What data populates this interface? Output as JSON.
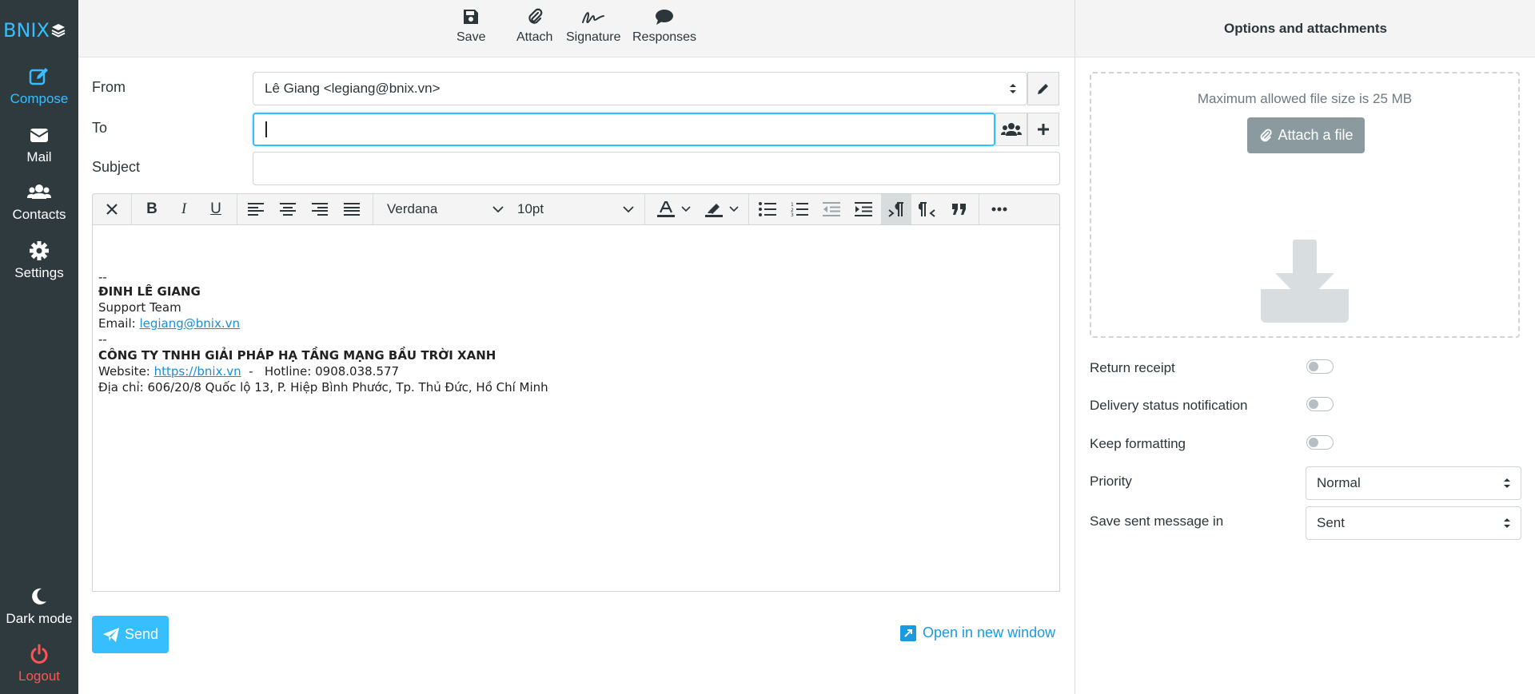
{
  "nav": {
    "logo_text": "BNIX",
    "items": [
      {
        "label": "Compose",
        "icon": "compose-icon"
      },
      {
        "label": "Mail",
        "icon": "envelope-icon"
      },
      {
        "label": "Contacts",
        "icon": "users-icon"
      },
      {
        "label": "Settings",
        "icon": "gear-icon"
      }
    ],
    "bottom": [
      {
        "label": "Dark mode",
        "icon": "moon-icon"
      },
      {
        "label": "Logout",
        "icon": "power-icon"
      }
    ]
  },
  "toolbar": {
    "save": "Save",
    "attach": "Attach",
    "signature": "Signature",
    "responses": "Responses"
  },
  "form": {
    "from_label": "From",
    "from_value": "Lê Giang <legiang@bnix.vn>",
    "to_label": "To",
    "to_value": "",
    "subject_label": "Subject",
    "subject_value": ""
  },
  "editor": {
    "font": "Verdana",
    "size": "10pt",
    "lines": {
      "sep1": "--",
      "name": "ĐINH LÊ GIANG",
      "team": "Support Team",
      "email_prefix": "Email: ",
      "email_link": "legiang@bnix.vn",
      "sep2": "--",
      "company": "CÔNG TY TNHH GIẢI PHÁP HẠ TẦNG MẠNG BẦU TRỜI XANH",
      "website_prefix": "Website: ",
      "website_link": "https://bnix.vn",
      "website_suffix": "  -   Hotline: 0908.038.577",
      "address": "Địa chỉ: 606/20/8 Quốc lộ 13, P. Hiệp Bình Phước, Tp. Thủ Đức, Hồ Chí Minh"
    }
  },
  "footer": {
    "send": "Send",
    "open_new_window": "Open in new window"
  },
  "options": {
    "title": "Options and attachments",
    "max_size": "Maximum allowed file size is 25 MB",
    "attach_file": "Attach a file",
    "return_receipt": "Return receipt",
    "delivery_status": "Delivery status notification",
    "keep_formatting": "Keep formatting",
    "priority_label": "Priority",
    "priority_value": "Normal",
    "save_sent_label": "Save sent message in",
    "save_sent_value": "Sent",
    "return_receipt_on": false,
    "delivery_status_on": false,
    "keep_formatting_on": false
  },
  "colors": {
    "accent": "#37beff",
    "nav_bg": "#2f3a3f",
    "logout": "#ff5552"
  }
}
